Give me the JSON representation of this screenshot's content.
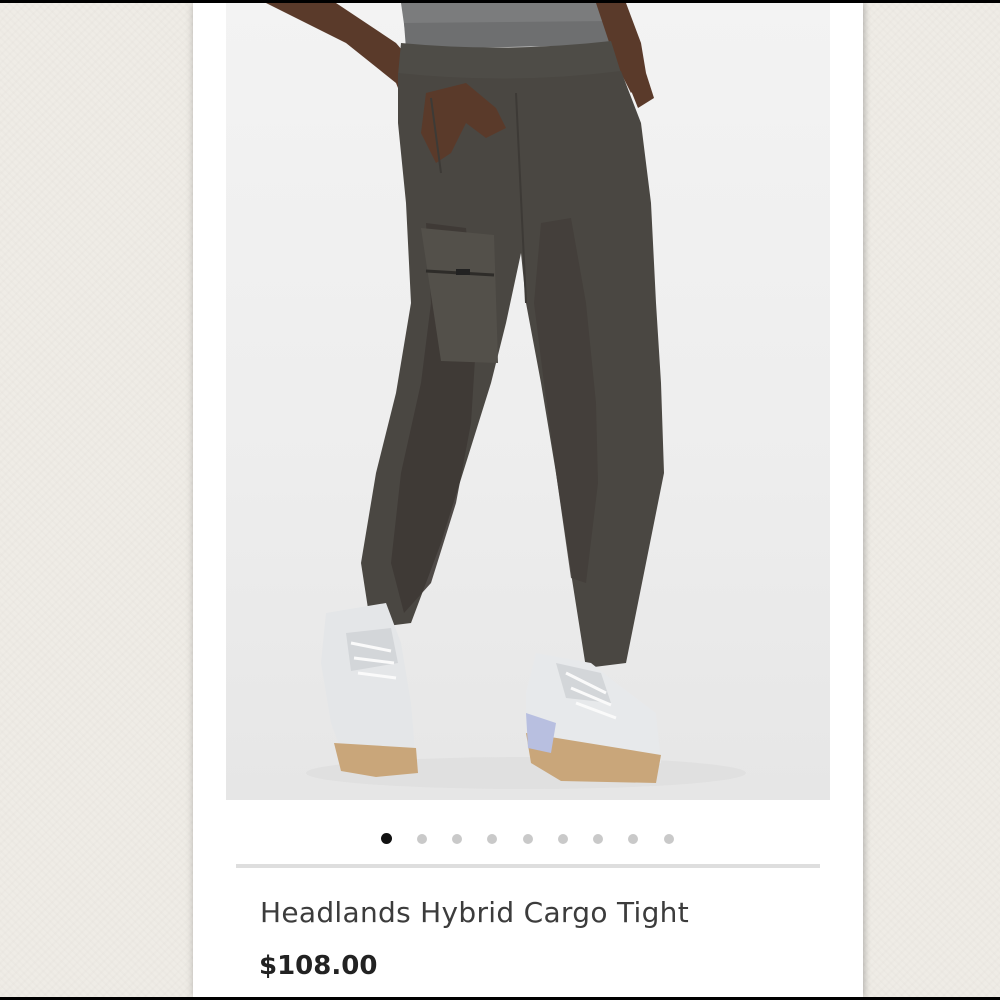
{
  "product": {
    "name": "Headlands Hybrid Cargo Tight",
    "price": "$108.00",
    "image_alt": "Headlands Hybrid Cargo Tight",
    "color": "#4a4742"
  },
  "carousel": {
    "total": 9,
    "active_index": 0,
    "dots": [
      "1",
      "2",
      "3",
      "4",
      "5",
      "6",
      "7",
      "8",
      "9"
    ]
  },
  "colors": {
    "background": "#efece6",
    "card": "#ffffff",
    "active_dot": "#111111",
    "inactive_dot": "#c9c9c9",
    "divider": "#dedede"
  }
}
